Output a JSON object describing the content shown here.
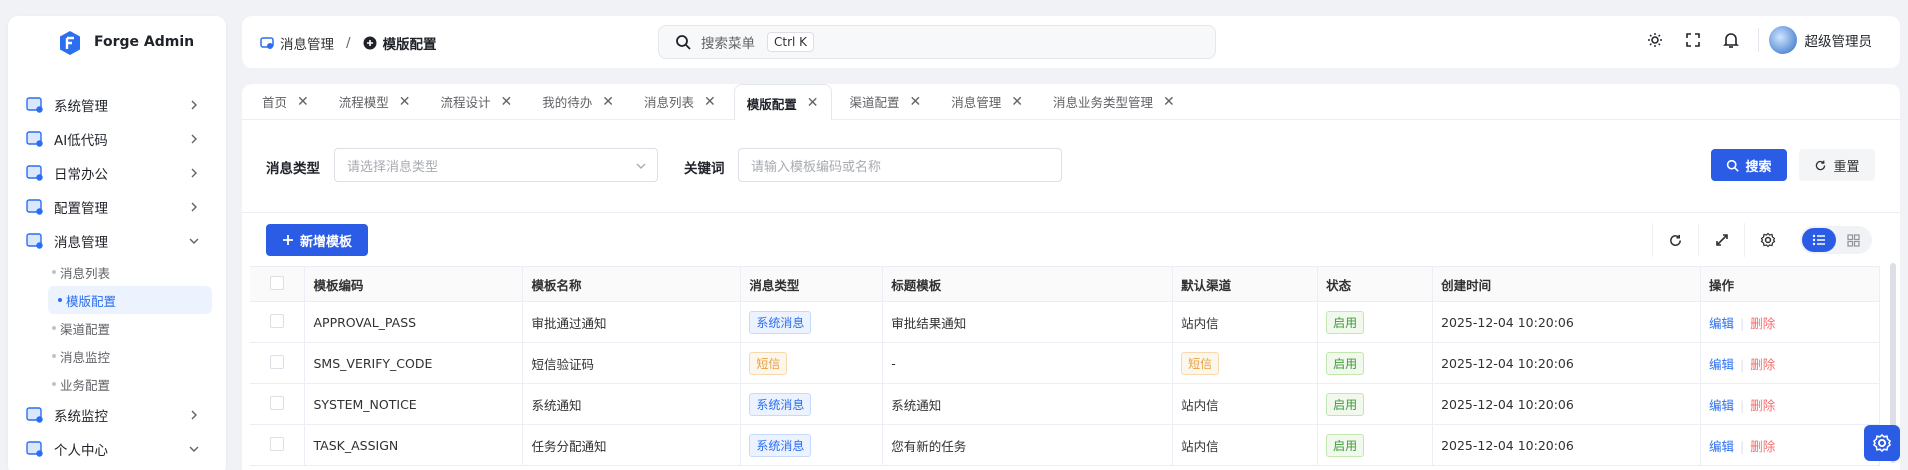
{
  "app": {
    "name": "Forge Admin"
  },
  "sidebar": {
    "items": [
      {
        "label": "系统管理",
        "icon": "system-icon",
        "expanded": false
      },
      {
        "label": "AI低代码",
        "icon": "ai-code-icon",
        "expanded": false
      },
      {
        "label": "日常办公",
        "icon": "office-icon",
        "expanded": false
      },
      {
        "label": "配置管理",
        "icon": "config-icon",
        "expanded": false
      },
      {
        "label": "消息管理",
        "icon": "message-icon",
        "expanded": true
      }
    ],
    "subitems": [
      "消息列表",
      "模版配置",
      "渠道配置",
      "消息监控",
      "业务配置"
    ],
    "active_sub": "模版配置",
    "items_after": [
      {
        "label": "系统监控",
        "icon": "monitor-icon",
        "expanded": false
      },
      {
        "label": "个人中心",
        "icon": "user-center-icon",
        "expanded": true
      }
    ]
  },
  "header": {
    "breadcrumb": [
      "消息管理",
      "模版配置"
    ],
    "search_placeholder": "搜索菜单",
    "search_shortcut": "Ctrl K",
    "user_name": "超级管理员"
  },
  "tabs": [
    "首页",
    "流程模型",
    "流程设计",
    "我的待办",
    "消息列表",
    "模版配置",
    "渠道配置",
    "消息管理",
    "消息业务类型管理"
  ],
  "active_tab": "模版配置",
  "filter": {
    "type_label": "消息类型",
    "type_placeholder": "请选择消息类型",
    "keyword_label": "关键词",
    "keyword_placeholder": "请输入模板编码或名称",
    "search_btn": "搜索",
    "reset_btn": "重置"
  },
  "toolbar": {
    "add_btn": "新增模板"
  },
  "table": {
    "headers": [
      "模板编码",
      "模板名称",
      "消息类型",
      "标题模板",
      "默认渠道",
      "状态",
      "创建时间",
      "操作"
    ],
    "rows": [
      {
        "code": "APPROVAL_PASS",
        "name": "审批通过通知",
        "type": "系统消息",
        "title": "审批结果通知",
        "channel": "站内信",
        "status": "启用",
        "created": "2025-12-04 10:20:06"
      },
      {
        "code": "SMS_VERIFY_CODE",
        "name": "短信验证码",
        "type": "短信",
        "title": "-",
        "channel": "短信",
        "status": "启用",
        "created": "2025-12-04 10:20:06"
      },
      {
        "code": "SYSTEM_NOTICE",
        "name": "系统通知",
        "type": "系统消息",
        "title": "系统通知",
        "channel": "站内信",
        "status": "启用",
        "created": "2025-12-04 10:20:06"
      },
      {
        "code": "TASK_ASSIGN",
        "name": "任务分配通知",
        "type": "系统消息",
        "title": "您有新的任务",
        "channel": "站内信",
        "status": "启用",
        "created": "2025-12-04 10:20:06"
      }
    ],
    "op_edit": "编辑",
    "op_delete": "删除"
  },
  "colors": {
    "primary": "#2b5ce6",
    "danger": "#f56c6c",
    "success": "#3f9b3f",
    "warning": "#e6a23c"
  }
}
